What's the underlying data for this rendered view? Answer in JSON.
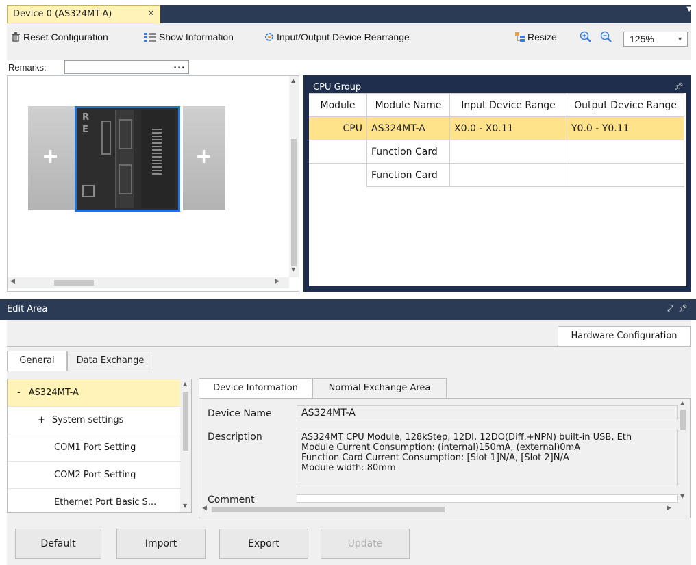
{
  "document_tab": {
    "title": "Device 0 (AS324MT-A)",
    "close": "×"
  },
  "toolbar": {
    "reset_label": "Reset Configuration",
    "show_info_label": "Show Information",
    "rearrange_label": "Input/Output Device Rearrange",
    "resize_label": "Resize",
    "zoom_value": "125%"
  },
  "remarks": {
    "label": "Remarks:",
    "value": "",
    "browse": "..."
  },
  "preview": {
    "left_slot": "+",
    "right_slot": "+",
    "module_letters": [
      "R",
      "E"
    ]
  },
  "cpu_group": {
    "title": "CPU Group",
    "columns": [
      "Module",
      "Module Name",
      "Input Device Range",
      "Output Device Range"
    ],
    "rows": [
      {
        "module": "CPU",
        "name": "AS324MT-A",
        "input": "X0.0 - X0.11",
        "output": "Y0.0 - Y0.11",
        "selected": true
      },
      {
        "module": "",
        "name": "Function Card",
        "input": "",
        "output": "",
        "selected": false
      },
      {
        "module": "",
        "name": "Function Card",
        "input": "",
        "output": "",
        "selected": false
      }
    ]
  },
  "edit_area": {
    "title": "Edit Area",
    "hardware_tab": "Hardware Configuration",
    "tabs": [
      "General",
      "Data Exchange"
    ],
    "tree": [
      {
        "prefix": "-",
        "label": "AS324MT-A",
        "selected": true
      },
      {
        "prefix": "+",
        "label": "System settings",
        "selected": false
      },
      {
        "prefix": "",
        "label": "COM1 Port Setting",
        "selected": false
      },
      {
        "prefix": "",
        "label": "COM2 Port Setting",
        "selected": false
      },
      {
        "prefix": "",
        "label": "Ethernet Port Basic S...",
        "selected": false
      }
    ],
    "detail_tabs": [
      "Device Information",
      "Normal Exchange Area"
    ],
    "device_name_label": "Device Name",
    "device_name_value": "AS324MT-A",
    "description_label": "Description",
    "description_lines": [
      "AS324MT CPU Module, 128kStep, 12DI, 12DO(Diff.+NPN) built-in USB, Eth",
      "Module Current Consumption: (internal)150mA, (external)0mA",
      "Function Card Current Consumption: [Slot 1]N/A, [Slot 2]N/A",
      "Module width: 80mm"
    ],
    "comment_label": "Comment"
  },
  "buttons": {
    "default": "Default",
    "import": "Import",
    "export": "Export",
    "update": "Update"
  }
}
